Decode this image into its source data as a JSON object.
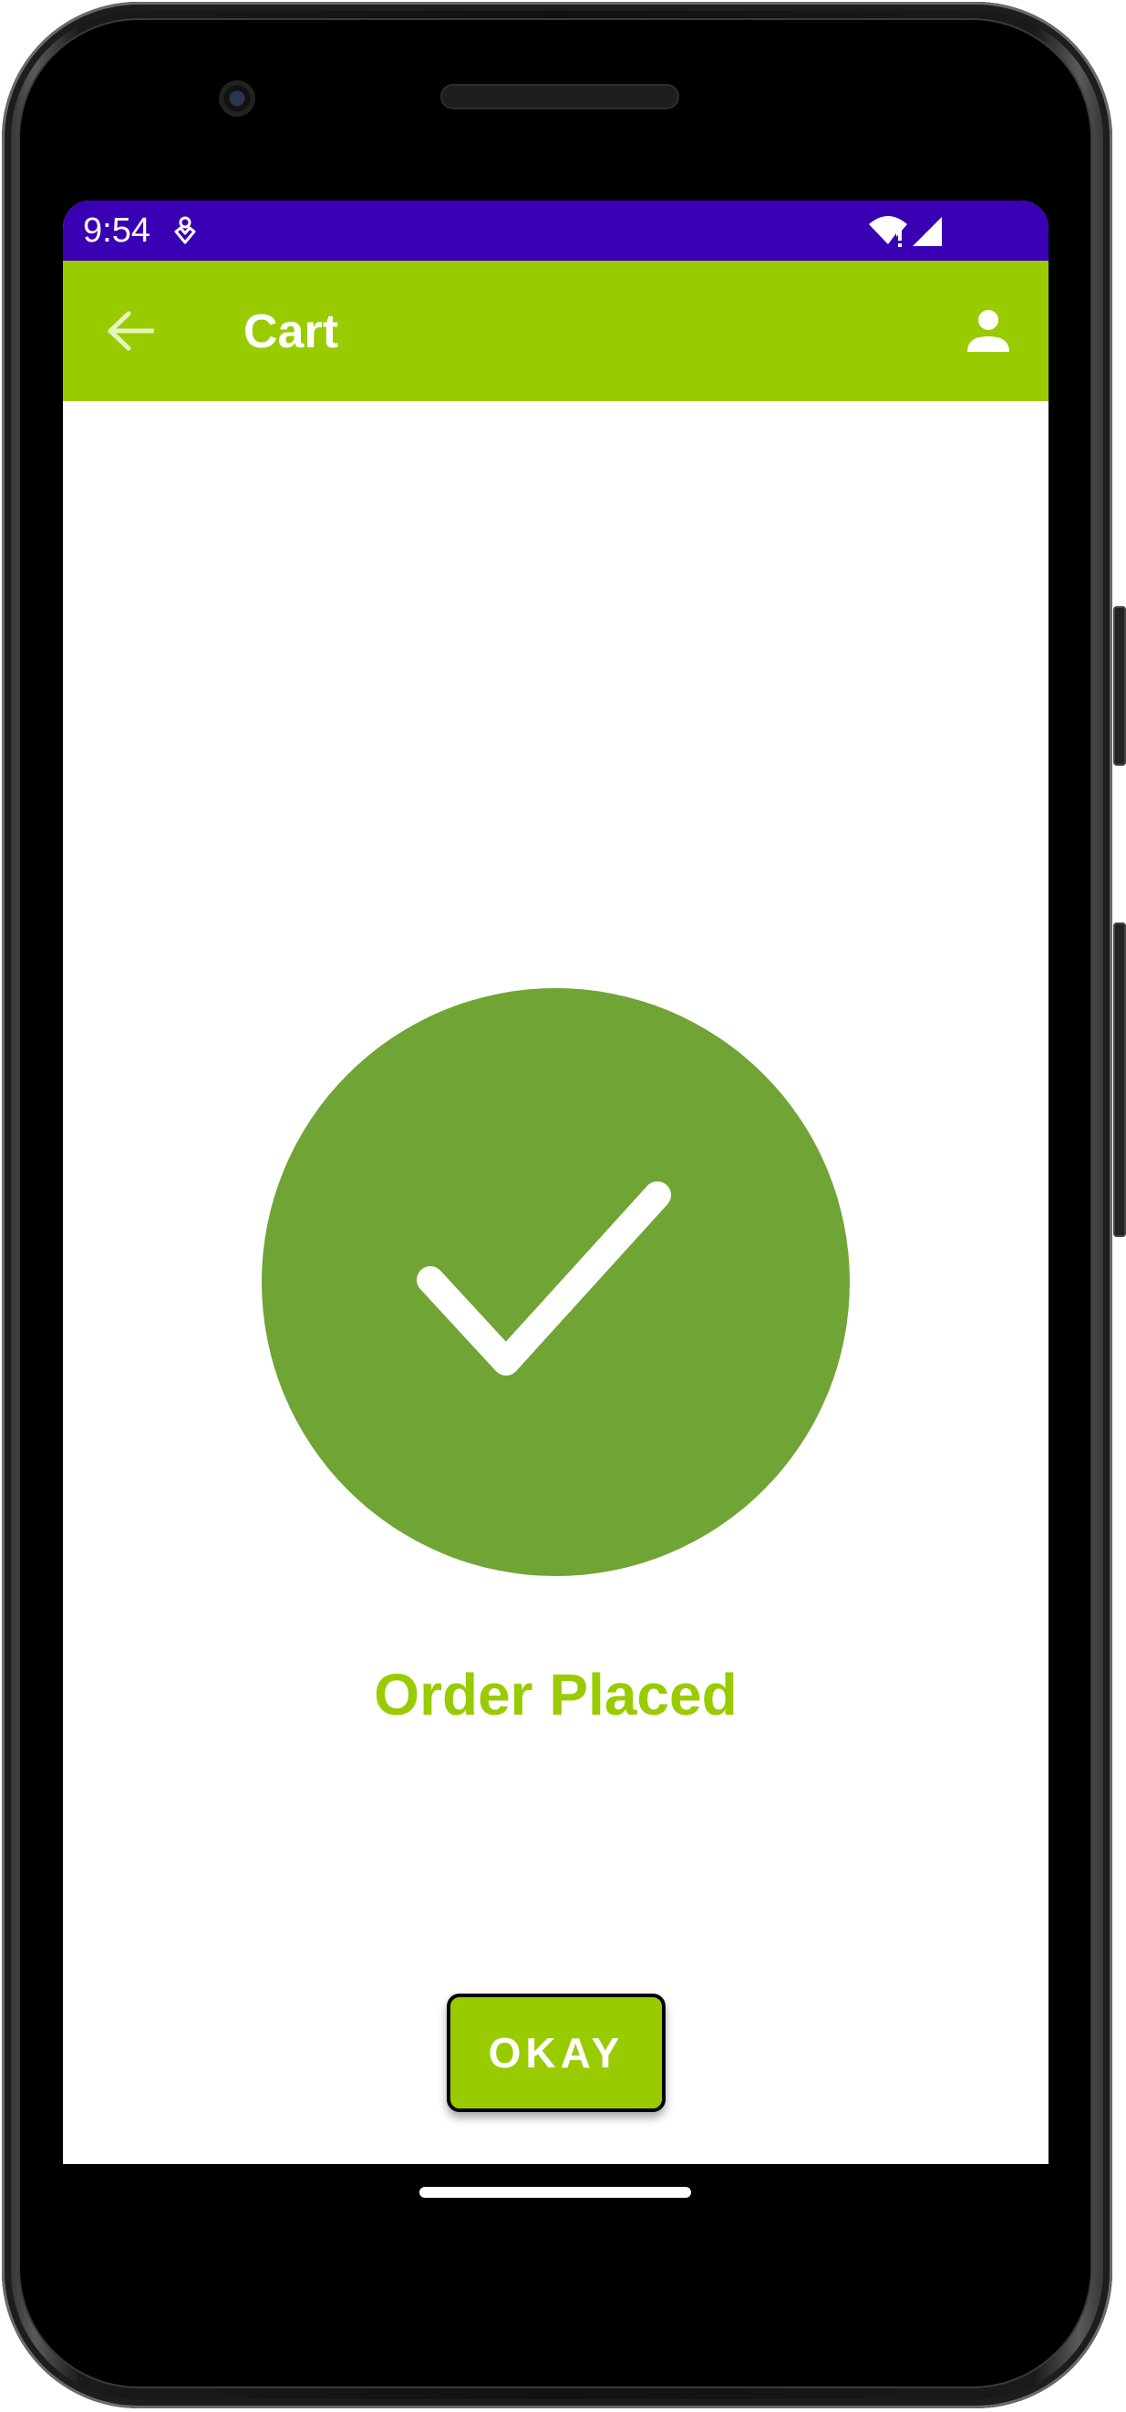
{
  "status_bar": {
    "time": "9:54",
    "background_color": "#3a00b3",
    "icons": [
      "notification-icon",
      "wifi-alert-icon",
      "cell-signal-icon"
    ]
  },
  "app_bar": {
    "title": "Cart",
    "background_color": "#99cc00",
    "back_icon": "arrow-back-icon",
    "account_icon": "person-icon"
  },
  "content": {
    "success_icon": "check-circle-icon",
    "success_color": "#70a434",
    "title": "Order Placed",
    "title_color": "#99cc00",
    "button_label": "OKAY"
  },
  "navigation": {
    "home_indicator": "home-gesture-bar"
  }
}
